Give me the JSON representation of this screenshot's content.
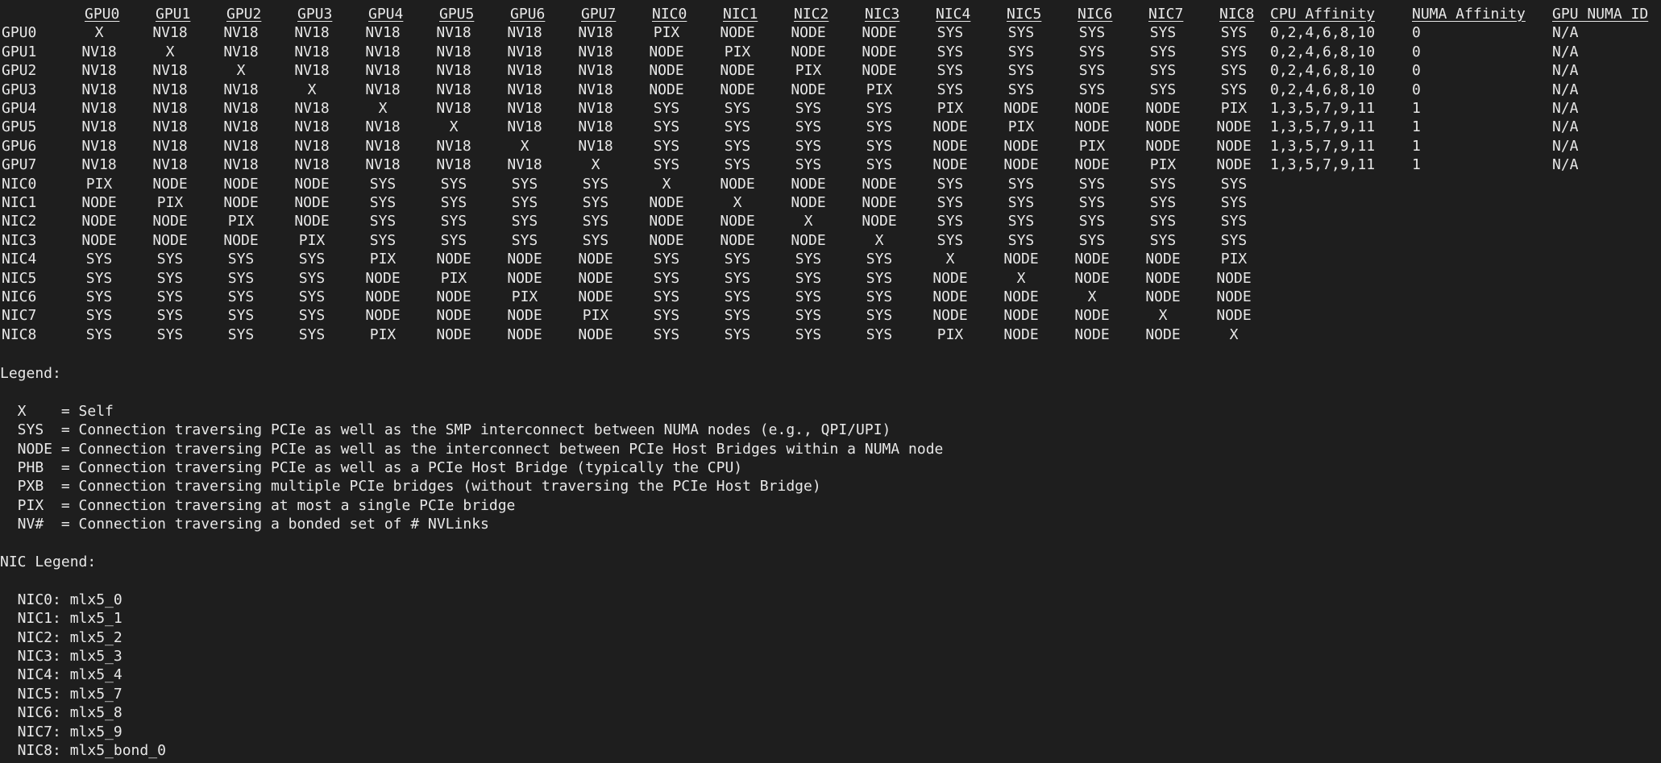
{
  "topo": {
    "header": [
      "GPU0",
      "GPU1",
      "GPU2",
      "GPU3",
      "GPU4",
      "GPU5",
      "GPU6",
      "GPU7",
      "NIC0",
      "NIC1",
      "NIC2",
      "NIC3",
      "NIC4",
      "NIC5",
      "NIC6",
      "NIC7",
      "NIC8",
      "CPU Affinity",
      "NUMA Affinity",
      "GPU NUMA ID"
    ],
    "rows": [
      {
        "label": "GPU0",
        "cells": [
          "X",
          "NV18",
          "NV18",
          "NV18",
          "NV18",
          "NV18",
          "NV18",
          "NV18",
          "PIX",
          "NODE",
          "NODE",
          "NODE",
          "SYS",
          "SYS",
          "SYS",
          "SYS",
          "SYS",
          "0,2,4,6,8,10",
          "0",
          "N/A"
        ]
      },
      {
        "label": "GPU1",
        "cells": [
          "NV18",
          "X",
          "NV18",
          "NV18",
          "NV18",
          "NV18",
          "NV18",
          "NV18",
          "NODE",
          "PIX",
          "NODE",
          "NODE",
          "SYS",
          "SYS",
          "SYS",
          "SYS",
          "SYS",
          "0,2,4,6,8,10",
          "0",
          "N/A"
        ]
      },
      {
        "label": "GPU2",
        "cells": [
          "NV18",
          "NV18",
          "X",
          "NV18",
          "NV18",
          "NV18",
          "NV18",
          "NV18",
          "NODE",
          "NODE",
          "PIX",
          "NODE",
          "SYS",
          "SYS",
          "SYS",
          "SYS",
          "SYS",
          "0,2,4,6,8,10",
          "0",
          "N/A"
        ]
      },
      {
        "label": "GPU3",
        "cells": [
          "NV18",
          "NV18",
          "NV18",
          "X",
          "NV18",
          "NV18",
          "NV18",
          "NV18",
          "NODE",
          "NODE",
          "NODE",
          "PIX",
          "SYS",
          "SYS",
          "SYS",
          "SYS",
          "SYS",
          "0,2,4,6,8,10",
          "0",
          "N/A"
        ]
      },
      {
        "label": "GPU4",
        "cells": [
          "NV18",
          "NV18",
          "NV18",
          "NV18",
          "X",
          "NV18",
          "NV18",
          "NV18",
          "SYS",
          "SYS",
          "SYS",
          "SYS",
          "PIX",
          "NODE",
          "NODE",
          "NODE",
          "PIX",
          "1,3,5,7,9,11",
          "1",
          "N/A"
        ]
      },
      {
        "label": "GPU5",
        "cells": [
          "NV18",
          "NV18",
          "NV18",
          "NV18",
          "NV18",
          "X",
          "NV18",
          "NV18",
          "SYS",
          "SYS",
          "SYS",
          "SYS",
          "NODE",
          "PIX",
          "NODE",
          "NODE",
          "NODE",
          "1,3,5,7,9,11",
          "1",
          "N/A"
        ]
      },
      {
        "label": "GPU6",
        "cells": [
          "NV18",
          "NV18",
          "NV18",
          "NV18",
          "NV18",
          "NV18",
          "X",
          "NV18",
          "SYS",
          "SYS",
          "SYS",
          "SYS",
          "NODE",
          "NODE",
          "PIX",
          "NODE",
          "NODE",
          "1,3,5,7,9,11",
          "1",
          "N/A"
        ]
      },
      {
        "label": "GPU7",
        "cells": [
          "NV18",
          "NV18",
          "NV18",
          "NV18",
          "NV18",
          "NV18",
          "NV18",
          "X",
          "SYS",
          "SYS",
          "SYS",
          "SYS",
          "NODE",
          "NODE",
          "NODE",
          "PIX",
          "NODE",
          "1,3,5,7,9,11",
          "1",
          "N/A"
        ]
      },
      {
        "label": "NIC0",
        "cells": [
          "PIX",
          "NODE",
          "NODE",
          "NODE",
          "SYS",
          "SYS",
          "SYS",
          "SYS",
          "X",
          "NODE",
          "NODE",
          "NODE",
          "SYS",
          "SYS",
          "SYS",
          "SYS",
          "SYS",
          "",
          "",
          ""
        ]
      },
      {
        "label": "NIC1",
        "cells": [
          "NODE",
          "PIX",
          "NODE",
          "NODE",
          "SYS",
          "SYS",
          "SYS",
          "SYS",
          "NODE",
          "X",
          "NODE",
          "NODE",
          "SYS",
          "SYS",
          "SYS",
          "SYS",
          "SYS",
          "",
          "",
          ""
        ]
      },
      {
        "label": "NIC2",
        "cells": [
          "NODE",
          "NODE",
          "PIX",
          "NODE",
          "SYS",
          "SYS",
          "SYS",
          "SYS",
          "NODE",
          "NODE",
          "X",
          "NODE",
          "SYS",
          "SYS",
          "SYS",
          "SYS",
          "SYS",
          "",
          "",
          ""
        ]
      },
      {
        "label": "NIC3",
        "cells": [
          "NODE",
          "NODE",
          "NODE",
          "PIX",
          "SYS",
          "SYS",
          "SYS",
          "SYS",
          "NODE",
          "NODE",
          "NODE",
          "X",
          "SYS",
          "SYS",
          "SYS",
          "SYS",
          "SYS",
          "",
          "",
          ""
        ]
      },
      {
        "label": "NIC4",
        "cells": [
          "SYS",
          "SYS",
          "SYS",
          "SYS",
          "PIX",
          "NODE",
          "NODE",
          "NODE",
          "SYS",
          "SYS",
          "SYS",
          "SYS",
          "X",
          "NODE",
          "NODE",
          "NODE",
          "PIX",
          "",
          "",
          ""
        ]
      },
      {
        "label": "NIC5",
        "cells": [
          "SYS",
          "SYS",
          "SYS",
          "SYS",
          "NODE",
          "PIX",
          "NODE",
          "NODE",
          "SYS",
          "SYS",
          "SYS",
          "SYS",
          "NODE",
          "X",
          "NODE",
          "NODE",
          "NODE",
          "",
          "",
          ""
        ]
      },
      {
        "label": "NIC6",
        "cells": [
          "SYS",
          "SYS",
          "SYS",
          "SYS",
          "NODE",
          "NODE",
          "PIX",
          "NODE",
          "SYS",
          "SYS",
          "SYS",
          "SYS",
          "NODE",
          "NODE",
          "X",
          "NODE",
          "NODE",
          "",
          "",
          ""
        ]
      },
      {
        "label": "NIC7",
        "cells": [
          "SYS",
          "SYS",
          "SYS",
          "SYS",
          "NODE",
          "NODE",
          "NODE",
          "PIX",
          "SYS",
          "SYS",
          "SYS",
          "SYS",
          "NODE",
          "NODE",
          "NODE",
          "X",
          "NODE",
          "",
          "",
          ""
        ]
      },
      {
        "label": "NIC8",
        "cells": [
          "SYS",
          "SYS",
          "SYS",
          "SYS",
          "PIX",
          "NODE",
          "NODE",
          "NODE",
          "SYS",
          "SYS",
          "SYS",
          "SYS",
          "PIX",
          "NODE",
          "NODE",
          "NODE",
          "X",
          "",
          "",
          ""
        ]
      }
    ]
  },
  "legend": {
    "title": "Legend:",
    "lines": [
      "  X    = Self",
      "  SYS  = Connection traversing PCIe as well as the SMP interconnect between NUMA nodes (e.g., QPI/UPI)",
      "  NODE = Connection traversing PCIe as well as the interconnect between PCIe Host Bridges within a NUMA node",
      "  PHB  = Connection traversing PCIe as well as a PCIe Host Bridge (typically the CPU)",
      "  PXB  = Connection traversing multiple PCIe bridges (without traversing the PCIe Host Bridge)",
      "  PIX  = Connection traversing at most a single PCIe bridge",
      "  NV#  = Connection traversing a bonded set of # NVLinks"
    ]
  },
  "nic_legend": {
    "title": "NIC Legend:",
    "lines": [
      "  NIC0: mlx5_0",
      "  NIC1: mlx5_1",
      "  NIC2: mlx5_2",
      "  NIC3: mlx5_3",
      "  NIC4: mlx5_4",
      "  NIC5: mlx5_7",
      "  NIC6: mlx5_8",
      "  NIC7: mlx5_9",
      "  NIC8: mlx5_bond_0"
    ]
  }
}
